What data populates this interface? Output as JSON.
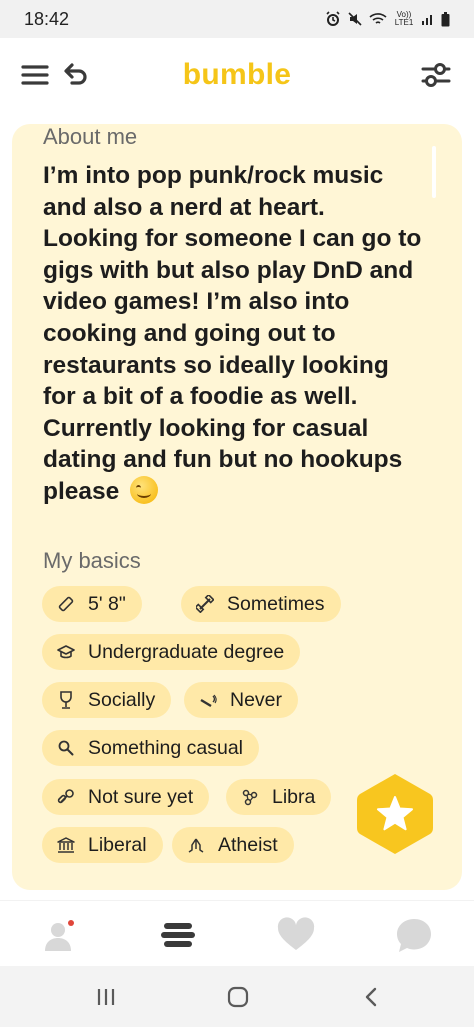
{
  "status_bar": {
    "time": "18:42",
    "network_label": "Vo)) LTE1"
  },
  "header": {
    "brand": "bumble",
    "brand_color": "#f5c518",
    "icons": [
      "menu-icon",
      "undo-icon",
      "filter-icon"
    ]
  },
  "profile": {
    "about_title": "About me",
    "about_text": "I’m into pop punk/rock music and also a nerd at heart. Looking for someone I can go to gigs with but also play DnD and video games! I’m also into cooking and going out to restaurants so ideally looking for a bit of a foodie as well. Currently looking for casual dating and fun but no hookups please",
    "about_emoji": "smiling-face-emoji",
    "basics_title": "My basics",
    "basics": [
      {
        "icon": "ruler-icon",
        "label": "5' 8\""
      },
      {
        "icon": "dumbbell-icon",
        "label": "Sometimes"
      },
      {
        "icon": "graduation-cap-icon",
        "label": "Undergraduate degree"
      },
      {
        "icon": "wine-glass-icon",
        "label": "Socially"
      },
      {
        "icon": "cigarette-icon",
        "label": "Never"
      },
      {
        "icon": "search-icon",
        "label": "Something casual"
      },
      {
        "icon": "pacifier-icon",
        "label": "Not sure yet"
      },
      {
        "icon": "zodiac-icon",
        "label": "Libra"
      },
      {
        "icon": "government-building-icon",
        "label": "Liberal"
      },
      {
        "icon": "praying-hands-icon",
        "label": "Atheist"
      }
    ]
  },
  "super_swipe": {
    "icon": "star-icon",
    "color": "#f8c61f"
  },
  "bottom_nav": [
    "profile-icon",
    "discover-icon",
    "likes-icon",
    "chats-icon"
  ],
  "colors": {
    "card_bg": "#fff6d6",
    "chip_bg": "#ffe9a8",
    "notification_dot": "#e0463a"
  }
}
